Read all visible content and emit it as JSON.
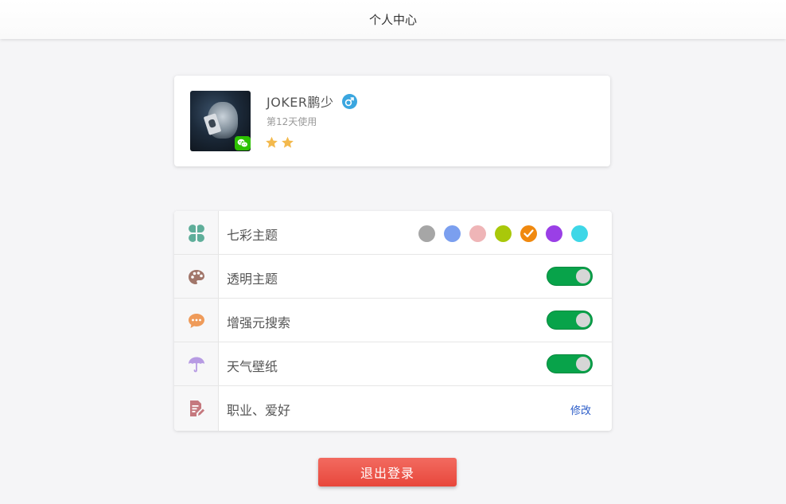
{
  "header": {
    "title": "个人中心"
  },
  "profile": {
    "username": "JOKER鹏少",
    "days_used": "第12天使用",
    "stars": 2,
    "gender": "male",
    "login_source": "wechat"
  },
  "settings": {
    "theme": {
      "label": "七彩主题",
      "colors": [
        "#a6a6a6",
        "#7b9fef",
        "#efb5b7",
        "#a9c80a",
        "#f0890f",
        "#9a3fe6",
        "#3ed7e7"
      ],
      "selected_color": "#f0890f"
    },
    "transparent": {
      "label": "透明主题",
      "enabled": true
    },
    "enhanced_search": {
      "label": "增强元搜索",
      "enabled": true
    },
    "weather_wallpaper": {
      "label": "天气壁纸",
      "enabled": true
    },
    "profession": {
      "label": "职业、爱好",
      "action": "修改"
    }
  },
  "logout": {
    "label": "退出登录"
  },
  "icons": {
    "theme": "clover-icon",
    "transparent": "palette-icon",
    "enhanced_search": "chat-bubble-icon",
    "weather_wallpaper": "umbrella-icon",
    "profession": "document-edit-icon"
  },
  "colors": {
    "toggle_on": "#08a34a",
    "logout": "#e8473b",
    "link": "#2b5cc8",
    "gender": "#3aa6df",
    "star": "#f3b94d"
  }
}
